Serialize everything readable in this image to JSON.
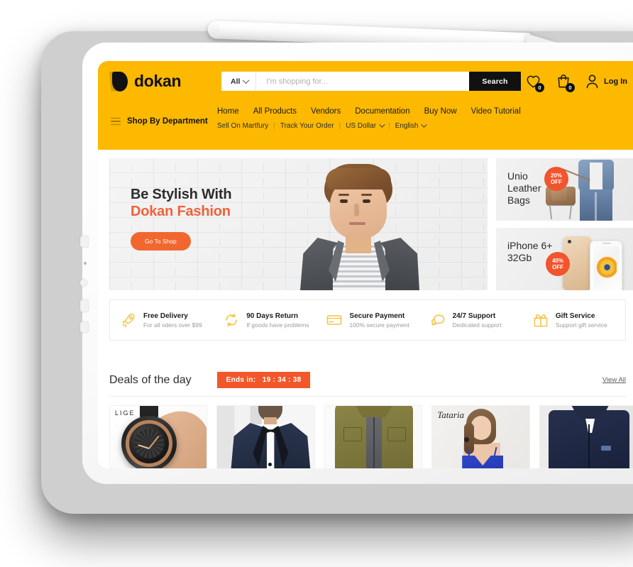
{
  "header": {
    "logo_text": "dokan",
    "search": {
      "category_label": "All",
      "placeholder": "I'm shopping for...",
      "button_label": "Search"
    },
    "wishlist_count": "0",
    "cart_count": "0",
    "login_label": "Log In"
  },
  "nav": {
    "department_label": "Shop By Department",
    "main_items": [
      {
        "label": "Home"
      },
      {
        "label": "All Products"
      },
      {
        "label": "Vendors"
      },
      {
        "label": "Documentation"
      },
      {
        "label": "Buy Now"
      },
      {
        "label": "Video Tutorial"
      }
    ],
    "sub_items": [
      {
        "label": "Sell On Martfury",
        "chevron": false
      },
      {
        "label": "Track Your Order",
        "chevron": false
      },
      {
        "label": "US Dollar",
        "chevron": true
      },
      {
        "label": "English",
        "chevron": true
      }
    ],
    "separator": "|"
  },
  "hero": {
    "line1": "Be Stylish With",
    "line2": "Dokan Fashion",
    "button_label": "Go To Shop"
  },
  "promos": [
    {
      "title": "Unio\nLeather\nBags",
      "title_line1": "Unio",
      "title_line2": "Leather",
      "title_line3": "Bags",
      "discount_pct": "20%",
      "discount_word": "OFF"
    },
    {
      "title_line1": "iPhone 6+",
      "title_line2": "32Gb",
      "title_line3": "",
      "discount_pct": "40%",
      "discount_word": "OFF"
    }
  ],
  "features": [
    {
      "icon": "rocket-icon",
      "title": "Free Delivery",
      "subtitle": "For all oders over $99"
    },
    {
      "icon": "refresh-icon",
      "title": "90 Days Return",
      "subtitle": "If goods have problems"
    },
    {
      "icon": "credit-card-icon",
      "title": "Secure Payment",
      "subtitle": "100% secure payment"
    },
    {
      "icon": "chat-icon",
      "title": "24/7 Support",
      "subtitle": "Dedicated support"
    },
    {
      "icon": "gift-icon",
      "title": "Gift Service",
      "subtitle": "Support gift service"
    }
  ],
  "deals": {
    "title": "Deals of the day",
    "ends_label": "Ends in:",
    "countdown": "19 : 34 : 38",
    "view_all_label": "View All",
    "products": [
      {
        "brand": "LIGE",
        "alt": "mechanical-watch"
      },
      {
        "brand": "",
        "alt": "navy-tuxedo"
      },
      {
        "brand": "",
        "alt": "olive-jacket"
      },
      {
        "brand": "Tataria",
        "alt": "blue-camisole-model"
      },
      {
        "brand": "",
        "alt": "navy-zip-jacket"
      }
    ]
  },
  "colors": {
    "brand_yellow": "#FCB900",
    "accent_orange": "#F2572A",
    "dark": "#111111",
    "feature_icon": "#F6C445"
  }
}
